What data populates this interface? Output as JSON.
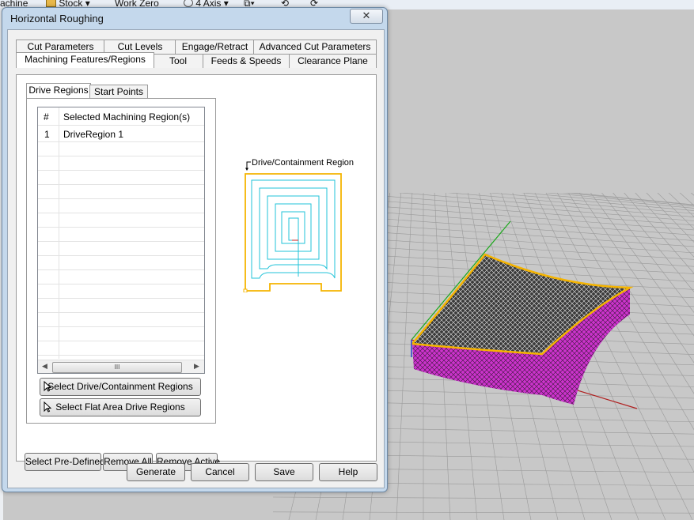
{
  "app": {
    "toolbar_items": [
      {
        "label": "achine"
      },
      {
        "label": "Stock ▾"
      },
      {
        "label": "Work Zero"
      },
      {
        "label": "4 Axis ▾"
      }
    ]
  },
  "dialog": {
    "title": "Horizontal Roughing",
    "close_glyph": "✕",
    "tabs_row1": [
      {
        "label": "Cut Parameters"
      },
      {
        "label": "Cut Levels"
      },
      {
        "label": "Engage/Retract"
      },
      {
        "label": "Advanced Cut Parameters"
      }
    ],
    "tabs_row2": [
      {
        "label": "Machining Features/Regions"
      },
      {
        "label": "Tool"
      },
      {
        "label": "Feeds & Speeds"
      },
      {
        "label": "Clearance Plane"
      }
    ],
    "subtabs": [
      {
        "label": "Drive Regions"
      },
      {
        "label": "Start Points"
      }
    ],
    "list": {
      "headers": [
        "#",
        "Selected Machining Region(s)"
      ],
      "rows": [
        {
          "num": "1",
          "name": "DriveRegion 1"
        }
      ],
      "scroll_thumb_glyph": "III"
    },
    "buttons": {
      "select_drive": "Select Drive/Containment Regions",
      "select_flat": "Select Flat Area Drive Regions",
      "select_predefined": "Select Pre-Defined",
      "remove_all": "Remove All",
      "remove_active": "Remove Active"
    },
    "preview": {
      "label": "Drive/Containment Region",
      "region_color": "#f5b400",
      "toolpath_color": "#22c3d8"
    },
    "footer": {
      "generate": "Generate",
      "cancel": "Cancel",
      "save": "Save",
      "help": "Help"
    }
  },
  "viewport": {
    "grid_color": "#9a9a9a",
    "part_edge_color": "#f5b400",
    "part_side_color": "#cc33cc",
    "part_mesh_color": "#111111"
  }
}
